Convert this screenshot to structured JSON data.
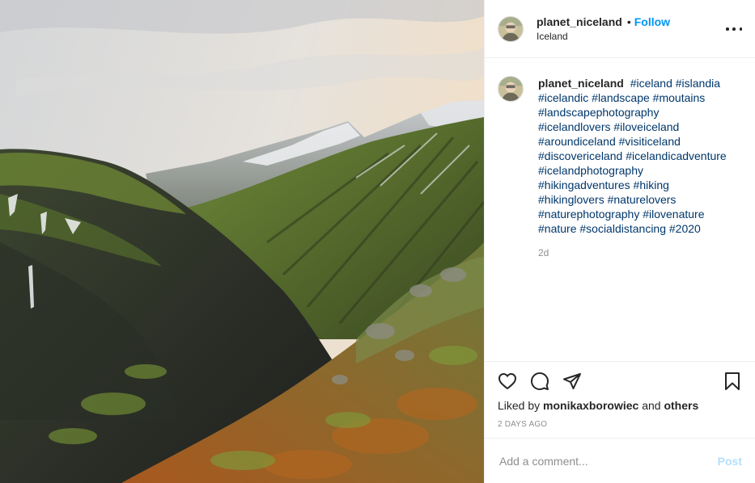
{
  "post": {
    "author": "planet_niceland",
    "follow_label": "Follow",
    "separator": "•",
    "location": "Iceland",
    "more_icon": "more-horizontal-icon"
  },
  "caption": {
    "author": "planet_niceland",
    "hashtags": [
      "#iceland",
      "#islandia",
      "#icelandic",
      "#landscape",
      "#moutains",
      "#landscapephotography",
      "#icelandlovers",
      "#iloveiceland",
      "#aroundiceland",
      "#visiticeland",
      "#discovericeland",
      "#icelandicadventure",
      "#icelandphotography",
      "#hikingadventures",
      "#hiking",
      "#hikinglovers",
      "#naturelovers",
      "#naturephotography",
      "#ilovenature",
      "#nature",
      "#socialdistancing",
      "#2020"
    ],
    "time_ago": "2d"
  },
  "actions": {
    "icons": [
      "heart-icon",
      "comment-icon",
      "share-icon",
      "bookmark-icon"
    ],
    "liked_by_prefix": "Liked by",
    "liked_by_user": "monikaxborowiec",
    "liked_by_and": "and",
    "liked_by_others": "others",
    "date": "2 DAYS AGO"
  },
  "comment": {
    "placeholder": "Add a comment...",
    "post_label": "Post"
  },
  "colors": {
    "link_blue": "#0095f6",
    "hashtag": "#00376b",
    "muted": "#8e8e8e",
    "post_disabled": "#b2dffc"
  }
}
